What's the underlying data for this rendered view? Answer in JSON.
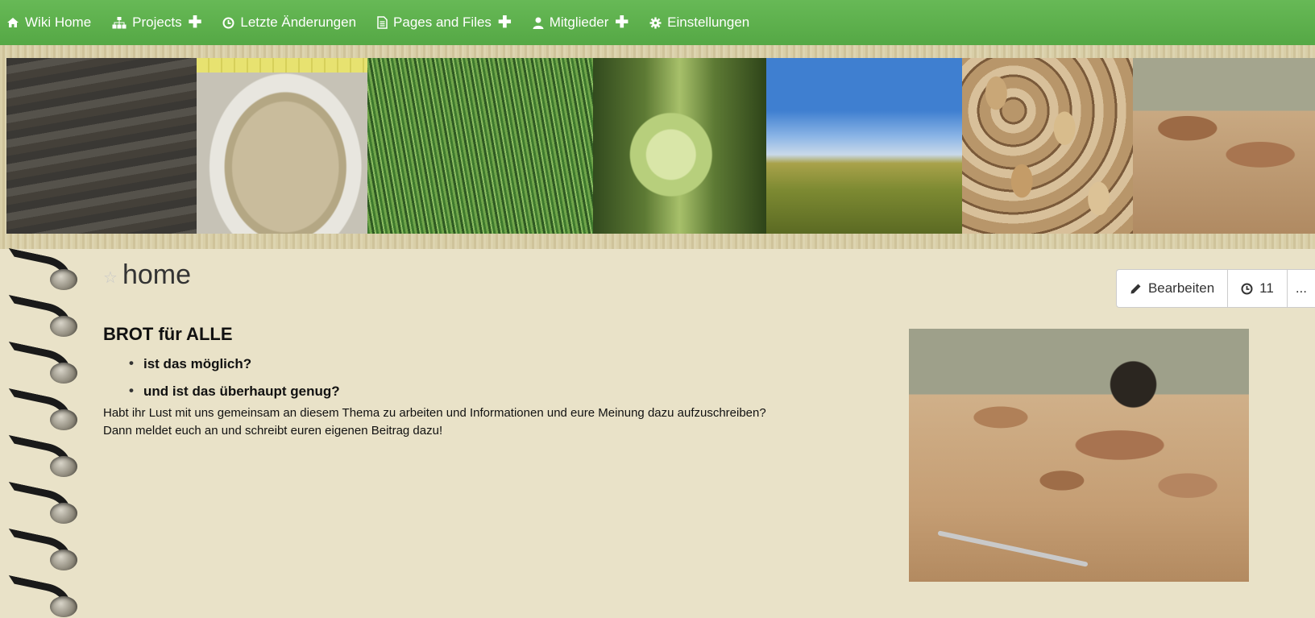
{
  "nav": {
    "items": [
      {
        "label": "Wiki Home",
        "icon": "home-icon",
        "plus": false
      },
      {
        "label": "Projects",
        "icon": "sitemap-icon",
        "plus": true
      },
      {
        "label": "Letzte Änderungen",
        "icon": "clock-icon",
        "plus": false
      },
      {
        "label": "Pages and Files",
        "icon": "file-icon",
        "plus": true
      },
      {
        "label": "Mitglieder",
        "icon": "user-icon",
        "plus": true
      },
      {
        "label": "Einstellungen",
        "icon": "gear-icon",
        "plus": false
      }
    ],
    "plus_symbol": "✚"
  },
  "page": {
    "title": "home"
  },
  "actions": {
    "edit_label": "Bearbeiten",
    "history_count": "11",
    "more_label": "..."
  },
  "article": {
    "heading": "BROT für ALLE",
    "bullets": [
      "ist das möglich?",
      "und ist das überhaupt genug?"
    ],
    "paragraph_1": "Habt ihr Lust mit uns gemeinsam an diesem Thema zu arbeiten und Informationen und eure Meinung dazu aufzuschreiben?",
    "paragraph_2": "Dann meldet euch an und schreibt euren eigenen Beitrag dazu!"
  },
  "colors": {
    "nav_bg": "#5cae4b",
    "page_bg": "#e9e2c8",
    "text": "#111111"
  }
}
